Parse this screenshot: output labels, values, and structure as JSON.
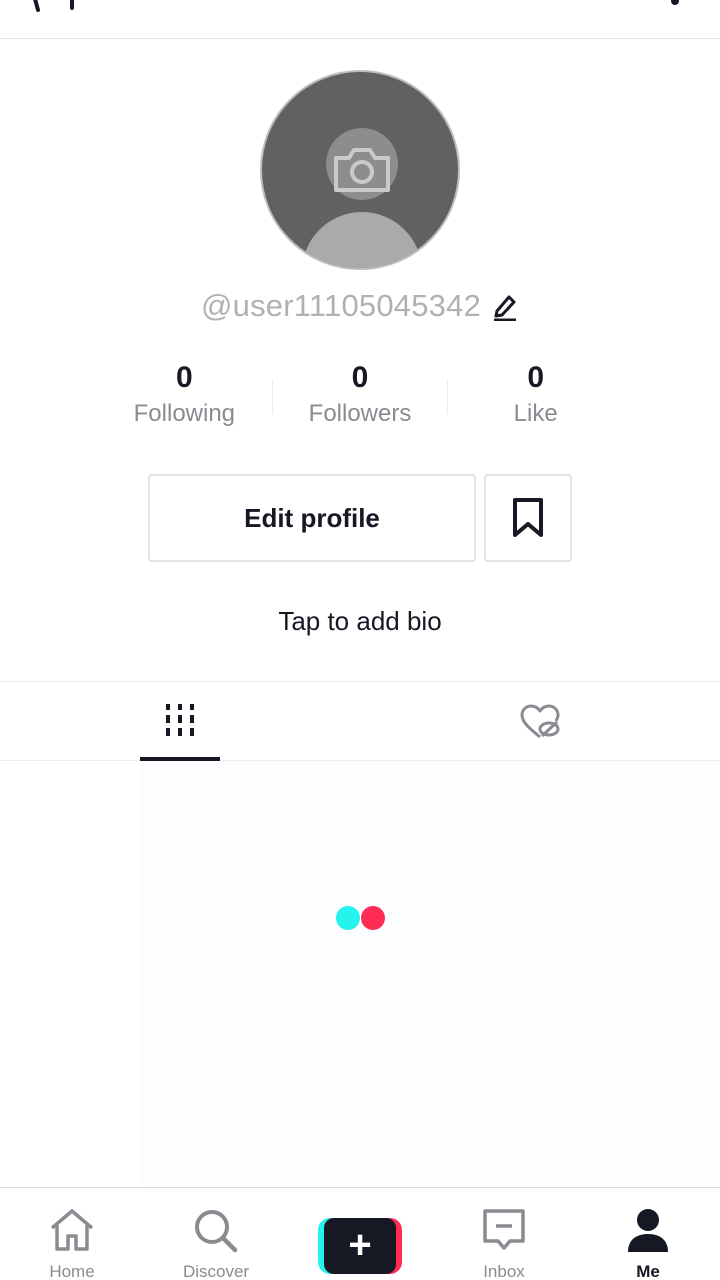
{
  "profile": {
    "username": "@user11105045342",
    "bio_prompt": "Tap to add bio"
  },
  "stats": [
    {
      "value": "0",
      "label": "Following"
    },
    {
      "value": "0",
      "label": "Followers"
    },
    {
      "value": "0",
      "label": "Like"
    }
  ],
  "actions": {
    "edit_profile_label": "Edit profile"
  },
  "tabs": [
    {
      "icon": "grid-icon",
      "active": true
    },
    {
      "icon": "liked-hidden-icon",
      "active": false
    }
  ],
  "bottom_nav": {
    "home_label": "Home",
    "discover_label": "Discover",
    "create_label": "+",
    "inbox_label": "Inbox",
    "me_label": "Me"
  },
  "colors": {
    "brand_cyan": "#25f4ee",
    "brand_red": "#fe2c55",
    "text_primary": "#161823",
    "text_secondary": "#8a8b91"
  }
}
